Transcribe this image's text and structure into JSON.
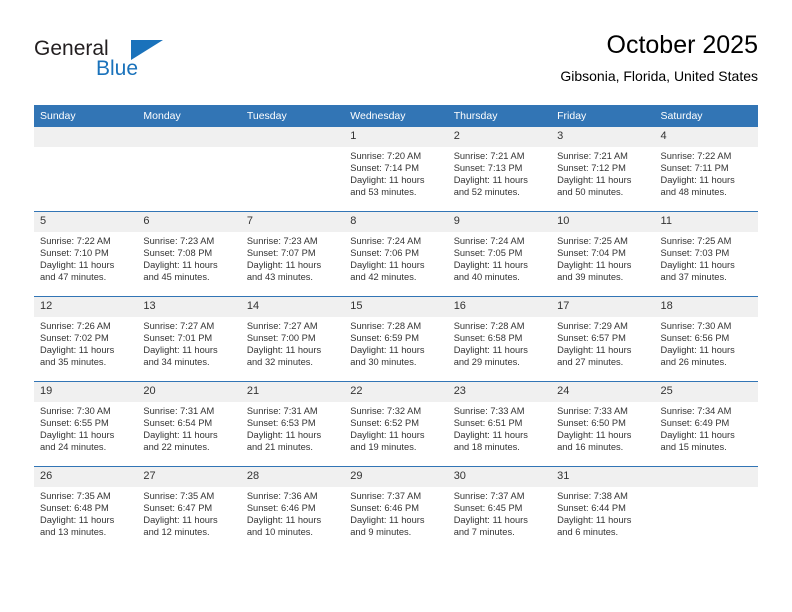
{
  "brand": {
    "name_part1": "General",
    "name_part2": "Blue",
    "accent_color": "#1a72bb",
    "logo_icon": "triangle-icon"
  },
  "header": {
    "title": "October 2025",
    "location": "Gibsonia, Florida, United States"
  },
  "colors": {
    "header_blue": "#3275b5",
    "daynum_band": "#f0f0f0",
    "text": "#333333"
  },
  "weekday_headers": [
    "Sunday",
    "Monday",
    "Tuesday",
    "Wednesday",
    "Thursday",
    "Friday",
    "Saturday"
  ],
  "labels": {
    "sunrise": "Sunrise:",
    "sunset": "Sunset:",
    "daylight": "Daylight:"
  },
  "weeks": [
    [
      {
        "day": "",
        "empty": true,
        "sunrise": "",
        "sunset": "",
        "daylight1": "",
        "daylight2": ""
      },
      {
        "day": "",
        "empty": true,
        "sunrise": "",
        "sunset": "",
        "daylight1": "",
        "daylight2": ""
      },
      {
        "day": "",
        "empty": true,
        "sunrise": "",
        "sunset": "",
        "daylight1": "",
        "daylight2": ""
      },
      {
        "day": "1",
        "empty": false,
        "sunrise": "Sunrise: 7:20 AM",
        "sunset": "Sunset: 7:14 PM",
        "daylight1": "Daylight: 11 hours",
        "daylight2": "and 53 minutes."
      },
      {
        "day": "2",
        "empty": false,
        "sunrise": "Sunrise: 7:21 AM",
        "sunset": "Sunset: 7:13 PM",
        "daylight1": "Daylight: 11 hours",
        "daylight2": "and 52 minutes."
      },
      {
        "day": "3",
        "empty": false,
        "sunrise": "Sunrise: 7:21 AM",
        "sunset": "Sunset: 7:12 PM",
        "daylight1": "Daylight: 11 hours",
        "daylight2": "and 50 minutes."
      },
      {
        "day": "4",
        "empty": false,
        "sunrise": "Sunrise: 7:22 AM",
        "sunset": "Sunset: 7:11 PM",
        "daylight1": "Daylight: 11 hours",
        "daylight2": "and 48 minutes."
      }
    ],
    [
      {
        "day": "5",
        "empty": false,
        "sunrise": "Sunrise: 7:22 AM",
        "sunset": "Sunset: 7:10 PM",
        "daylight1": "Daylight: 11 hours",
        "daylight2": "and 47 minutes."
      },
      {
        "day": "6",
        "empty": false,
        "sunrise": "Sunrise: 7:23 AM",
        "sunset": "Sunset: 7:08 PM",
        "daylight1": "Daylight: 11 hours",
        "daylight2": "and 45 minutes."
      },
      {
        "day": "7",
        "empty": false,
        "sunrise": "Sunrise: 7:23 AM",
        "sunset": "Sunset: 7:07 PM",
        "daylight1": "Daylight: 11 hours",
        "daylight2": "and 43 minutes."
      },
      {
        "day": "8",
        "empty": false,
        "sunrise": "Sunrise: 7:24 AM",
        "sunset": "Sunset: 7:06 PM",
        "daylight1": "Daylight: 11 hours",
        "daylight2": "and 42 minutes."
      },
      {
        "day": "9",
        "empty": false,
        "sunrise": "Sunrise: 7:24 AM",
        "sunset": "Sunset: 7:05 PM",
        "daylight1": "Daylight: 11 hours",
        "daylight2": "and 40 minutes."
      },
      {
        "day": "10",
        "empty": false,
        "sunrise": "Sunrise: 7:25 AM",
        "sunset": "Sunset: 7:04 PM",
        "daylight1": "Daylight: 11 hours",
        "daylight2": "and 39 minutes."
      },
      {
        "day": "11",
        "empty": false,
        "sunrise": "Sunrise: 7:25 AM",
        "sunset": "Sunset: 7:03 PM",
        "daylight1": "Daylight: 11 hours",
        "daylight2": "and 37 minutes."
      }
    ],
    [
      {
        "day": "12",
        "empty": false,
        "sunrise": "Sunrise: 7:26 AM",
        "sunset": "Sunset: 7:02 PM",
        "daylight1": "Daylight: 11 hours",
        "daylight2": "and 35 minutes."
      },
      {
        "day": "13",
        "empty": false,
        "sunrise": "Sunrise: 7:27 AM",
        "sunset": "Sunset: 7:01 PM",
        "daylight1": "Daylight: 11 hours",
        "daylight2": "and 34 minutes."
      },
      {
        "day": "14",
        "empty": false,
        "sunrise": "Sunrise: 7:27 AM",
        "sunset": "Sunset: 7:00 PM",
        "daylight1": "Daylight: 11 hours",
        "daylight2": "and 32 minutes."
      },
      {
        "day": "15",
        "empty": false,
        "sunrise": "Sunrise: 7:28 AM",
        "sunset": "Sunset: 6:59 PM",
        "daylight1": "Daylight: 11 hours",
        "daylight2": "and 30 minutes."
      },
      {
        "day": "16",
        "empty": false,
        "sunrise": "Sunrise: 7:28 AM",
        "sunset": "Sunset: 6:58 PM",
        "daylight1": "Daylight: 11 hours",
        "daylight2": "and 29 minutes."
      },
      {
        "day": "17",
        "empty": false,
        "sunrise": "Sunrise: 7:29 AM",
        "sunset": "Sunset: 6:57 PM",
        "daylight1": "Daylight: 11 hours",
        "daylight2": "and 27 minutes."
      },
      {
        "day": "18",
        "empty": false,
        "sunrise": "Sunrise: 7:30 AM",
        "sunset": "Sunset: 6:56 PM",
        "daylight1": "Daylight: 11 hours",
        "daylight2": "and 26 minutes."
      }
    ],
    [
      {
        "day": "19",
        "empty": false,
        "sunrise": "Sunrise: 7:30 AM",
        "sunset": "Sunset: 6:55 PM",
        "daylight1": "Daylight: 11 hours",
        "daylight2": "and 24 minutes."
      },
      {
        "day": "20",
        "empty": false,
        "sunrise": "Sunrise: 7:31 AM",
        "sunset": "Sunset: 6:54 PM",
        "daylight1": "Daylight: 11 hours",
        "daylight2": "and 22 minutes."
      },
      {
        "day": "21",
        "empty": false,
        "sunrise": "Sunrise: 7:31 AM",
        "sunset": "Sunset: 6:53 PM",
        "daylight1": "Daylight: 11 hours",
        "daylight2": "and 21 minutes."
      },
      {
        "day": "22",
        "empty": false,
        "sunrise": "Sunrise: 7:32 AM",
        "sunset": "Sunset: 6:52 PM",
        "daylight1": "Daylight: 11 hours",
        "daylight2": "and 19 minutes."
      },
      {
        "day": "23",
        "empty": false,
        "sunrise": "Sunrise: 7:33 AM",
        "sunset": "Sunset: 6:51 PM",
        "daylight1": "Daylight: 11 hours",
        "daylight2": "and 18 minutes."
      },
      {
        "day": "24",
        "empty": false,
        "sunrise": "Sunrise: 7:33 AM",
        "sunset": "Sunset: 6:50 PM",
        "daylight1": "Daylight: 11 hours",
        "daylight2": "and 16 minutes."
      },
      {
        "day": "25",
        "empty": false,
        "sunrise": "Sunrise: 7:34 AM",
        "sunset": "Sunset: 6:49 PM",
        "daylight1": "Daylight: 11 hours",
        "daylight2": "and 15 minutes."
      }
    ],
    [
      {
        "day": "26",
        "empty": false,
        "sunrise": "Sunrise: 7:35 AM",
        "sunset": "Sunset: 6:48 PM",
        "daylight1": "Daylight: 11 hours",
        "daylight2": "and 13 minutes."
      },
      {
        "day": "27",
        "empty": false,
        "sunrise": "Sunrise: 7:35 AM",
        "sunset": "Sunset: 6:47 PM",
        "daylight1": "Daylight: 11 hours",
        "daylight2": "and 12 minutes."
      },
      {
        "day": "28",
        "empty": false,
        "sunrise": "Sunrise: 7:36 AM",
        "sunset": "Sunset: 6:46 PM",
        "daylight1": "Daylight: 11 hours",
        "daylight2": "and 10 minutes."
      },
      {
        "day": "29",
        "empty": false,
        "sunrise": "Sunrise: 7:37 AM",
        "sunset": "Sunset: 6:46 PM",
        "daylight1": "Daylight: 11 hours",
        "daylight2": "and 9 minutes."
      },
      {
        "day": "30",
        "empty": false,
        "sunrise": "Sunrise: 7:37 AM",
        "sunset": "Sunset: 6:45 PM",
        "daylight1": "Daylight: 11 hours",
        "daylight2": "and 7 minutes."
      },
      {
        "day": "31",
        "empty": false,
        "sunrise": "Sunrise: 7:38 AM",
        "sunset": "Sunset: 6:44 PM",
        "daylight1": "Daylight: 11 hours",
        "daylight2": "and 6 minutes."
      },
      {
        "day": "",
        "empty": true,
        "sunrise": "",
        "sunset": "",
        "daylight1": "",
        "daylight2": ""
      }
    ]
  ]
}
